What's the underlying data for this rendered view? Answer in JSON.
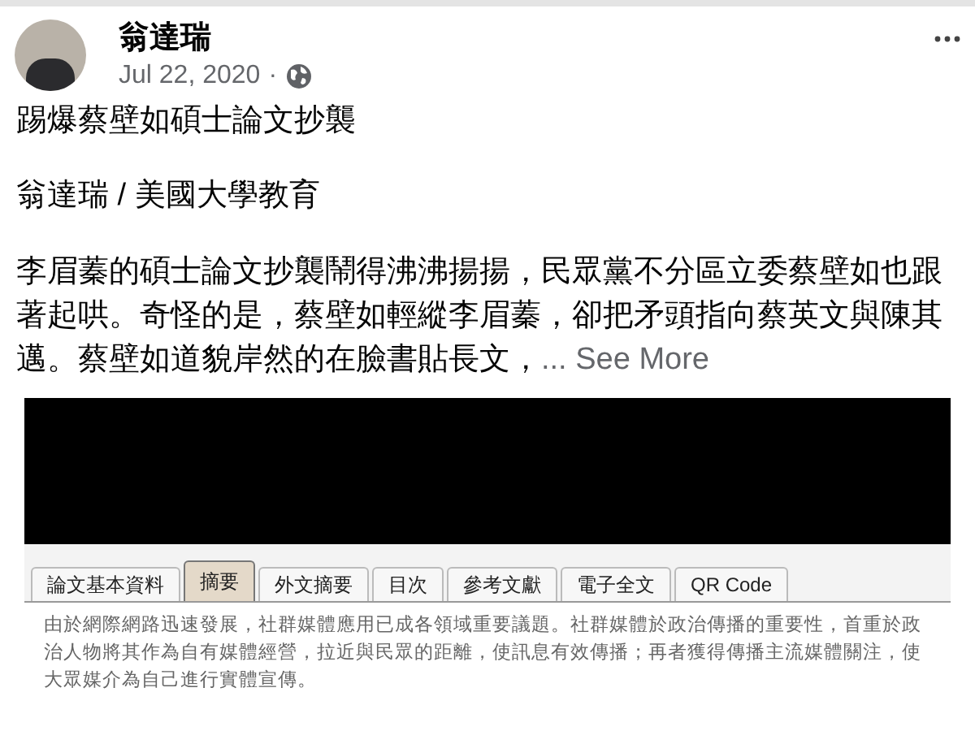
{
  "post": {
    "author": "翁達瑞",
    "date": "Jul 22, 2020",
    "separator": "·",
    "headline": "踢爆蔡壁如碩士論文抄襲",
    "byline": "翁達瑞 / 美國大學教育",
    "body": "李眉蓁的碩士論文抄襲鬧得沸沸揚揚，民眾黨不分區立委蔡壁如也跟著起哄。奇怪的是，蔡壁如輕縱李眉蓁，卻把矛頭指向蔡英文與陳其邁。蔡壁如道貌岸然的在臉書貼長文，",
    "see_more": "... See More"
  },
  "embedded_page": {
    "tabs": [
      {
        "label": "論文基本資料",
        "selected": false
      },
      {
        "label": "摘要",
        "selected": true
      },
      {
        "label": "外文摘要",
        "selected": false
      },
      {
        "label": "目次",
        "selected": false
      },
      {
        "label": "參考文獻",
        "selected": false
      },
      {
        "label": "電子全文",
        "selected": false
      },
      {
        "label": "QR Code",
        "selected": false
      }
    ],
    "abstract": "由於網際網路迅速發展，社群媒體應用已成各領域重要議題。社群媒體於政治傳播的重要性，首重於政治人物將其作為自有媒體經營，拉近與民眾的距離，使訊息有效傳播；再者獲得傳播主流媒體關注，使大眾媒介為自己進行實體宣傳。"
  }
}
